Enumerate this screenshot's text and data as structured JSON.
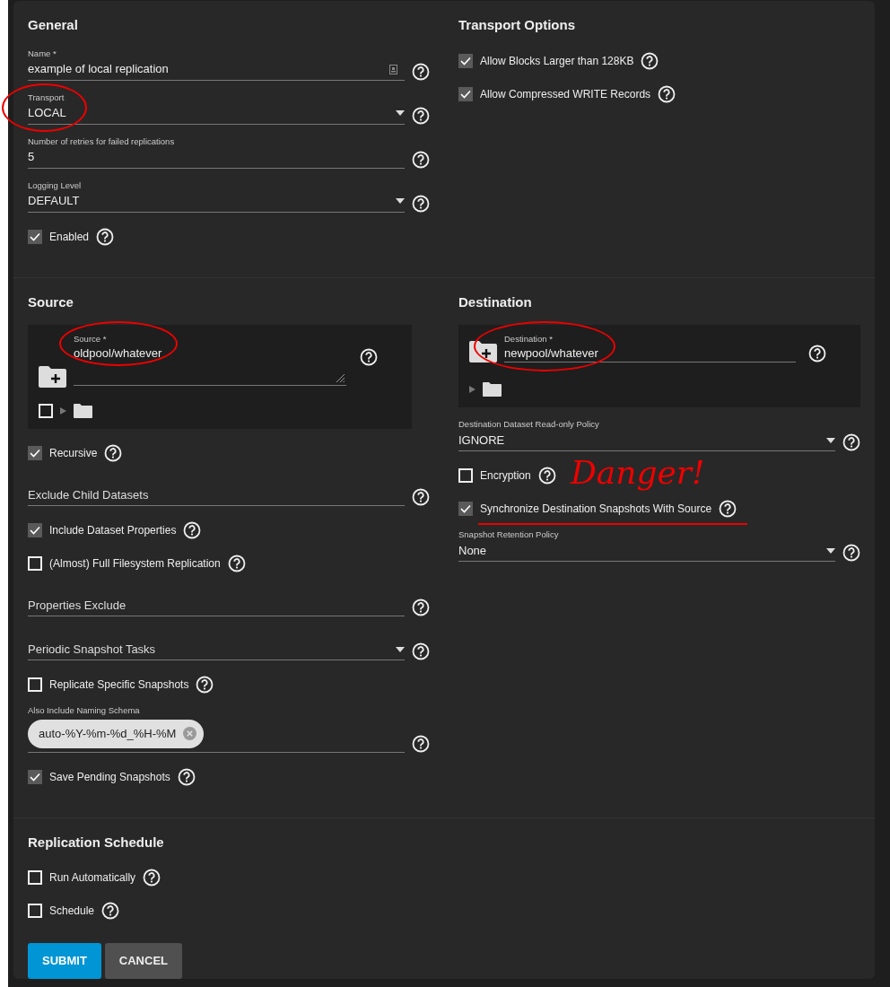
{
  "rows": [
    {
      "sections": [
        {
          "title": "General",
          "items": [
            {
              "kind": "input",
              "label": "Name *",
              "value": "example of local replication",
              "trailing_icon": true
            },
            {
              "kind": "select",
              "label": "Transport",
              "value": "LOCAL",
              "circled": true
            },
            {
              "kind": "input",
              "label": "Number of retries for failed replications",
              "value": "5"
            },
            {
              "kind": "select",
              "label": "Logging Level",
              "value": "DEFAULT"
            },
            {
              "kind": "checkbox",
              "label": "Enabled",
              "checked": true
            }
          ]
        },
        {
          "title": "Transport Options",
          "items": [
            {
              "kind": "checkbox",
              "label": "Allow Blocks Larger than 128KB",
              "checked": true
            },
            {
              "kind": "checkbox",
              "label": "Allow Compressed WRITE Records",
              "checked": true
            }
          ]
        }
      ]
    },
    {
      "sections": [
        {
          "title": "Source",
          "items": [
            {
              "kind": "explorer",
              "label": "Source *",
              "value": "oldpool/whatever",
              "circled": true,
              "multiline": true,
              "tree_checked": false
            },
            {
              "kind": "checkbox",
              "label": "Recursive",
              "checked": true
            },
            {
              "kind": "input",
              "placeholder": "Exclude Child Datasets"
            },
            {
              "kind": "checkbox",
              "label": "Include Dataset Properties",
              "checked": true
            },
            {
              "kind": "checkbox",
              "label": "(Almost) Full Filesystem Replication",
              "checked": false
            },
            {
              "kind": "input",
              "placeholder": "Properties Exclude"
            },
            {
              "kind": "select",
              "placeholder": "Periodic Snapshot Tasks"
            },
            {
              "kind": "checkbox",
              "label": "Replicate Specific Snapshots",
              "checked": false
            },
            {
              "kind": "chips",
              "label": "Also Include Naming Schema",
              "chips": [
                "auto-%Y-%m-%d_%H-%M"
              ]
            },
            {
              "kind": "checkbox",
              "label": "Save Pending Snapshots",
              "checked": true
            }
          ]
        },
        {
          "title": "Destination",
          "items": [
            {
              "kind": "explorer",
              "label": "Destination *",
              "value": "newpool/whatever",
              "circled": true,
              "multiline": false
            },
            {
              "kind": "select",
              "label": "Destination Dataset Read-only Policy",
              "value": "IGNORE"
            },
            {
              "kind": "checkbox",
              "label": "Encryption",
              "checked": false
            },
            {
              "kind": "checkbox",
              "label": "Synchronize Destination Snapshots With Source",
              "checked": true,
              "annotation": "Danger!"
            },
            {
              "kind": "select",
              "label": "Snapshot Retention Policy",
              "value": "None"
            }
          ]
        }
      ]
    },
    {
      "sections": [
        {
          "title": "Replication Schedule",
          "items": [
            {
              "kind": "checkbox",
              "label": "Run Automatically",
              "checked": false
            },
            {
              "kind": "checkbox",
              "label": "Schedule",
              "checked": false
            }
          ]
        }
      ]
    }
  ],
  "buttons": [
    {
      "label": "SUBMIT",
      "kind": "primary"
    },
    {
      "label": "CANCEL",
      "kind": "secondary"
    }
  ]
}
